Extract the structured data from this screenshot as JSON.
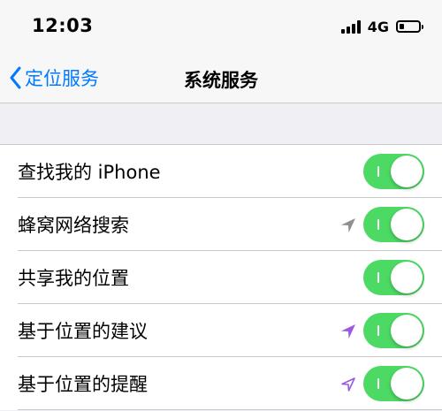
{
  "status_bar": {
    "time": "12:03",
    "network": "4G",
    "battery_level": 0.2
  },
  "nav": {
    "back_label": "定位服务",
    "title": "系统服务"
  },
  "colors": {
    "accent": "#007aff",
    "toggle_on": "#4cd964",
    "location_recent": "#9b59e0",
    "location_used": "#8e8e93"
  },
  "rows": [
    {
      "label": "查找我的 iPhone",
      "enabled": true,
      "location_icon": "none"
    },
    {
      "label": "蜂窝网络搜索",
      "enabled": true,
      "location_icon": "location-arrow-gray-icon"
    },
    {
      "label": "共享我的位置",
      "enabled": true,
      "location_icon": "none"
    },
    {
      "label": "基于位置的建议",
      "enabled": true,
      "location_icon": "location-arrow-purple-icon"
    },
    {
      "label": "基于位置的提醒",
      "enabled": true,
      "location_icon": "location-arrow-outline-purple-icon"
    }
  ]
}
